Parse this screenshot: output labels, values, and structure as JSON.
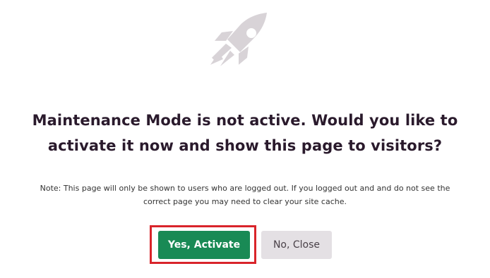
{
  "dialog": {
    "heading_line1": "Maintenance Mode is not active. Would you like to",
    "heading_line2": "activate it now and show this page to visitors?",
    "note_line1": "Note: This page will only be shown to users who are logged out. If you logged out and and do not see the",
    "note_line2": "correct page you may need to clear your site cache.",
    "icon": "rocket-icon",
    "activate_label": "Yes, Activate",
    "close_label": "No, Close"
  },
  "colors": {
    "primary_button": "#198a55",
    "secondary_button": "#e4e0e4",
    "highlight": "#d9242a",
    "icon": "#d8d3d7"
  }
}
